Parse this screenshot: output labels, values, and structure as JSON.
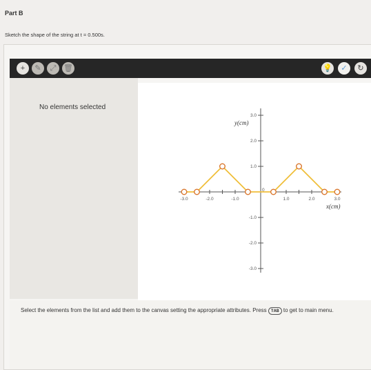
{
  "part_title": "Part B",
  "prompt": "Sketch the shape of the string at t = 0.500s.",
  "toolbar": {
    "add_icon": "plus-icon",
    "tool_icons": [
      "pen-icon",
      "transform-icon"
    ],
    "delete_icon": "trash-icon",
    "right_icons": [
      "hint-icon",
      "check-icon",
      "reset-icon"
    ]
  },
  "left_panel": {
    "status": "No elements selected"
  },
  "instructions": {
    "text_before": "Select the elements from the list and add them to the canvas setting the appropriate attributes. Press",
    "key": "TAB",
    "text_after": "to get to main menu."
  },
  "chart_data": {
    "type": "line",
    "xlabel": "x(cm)",
    "ylabel": "y(cm)",
    "origin_label": "0",
    "xlim": [
      -3.0,
      3.0
    ],
    "ylim": [
      -3.0,
      3.0
    ],
    "x_ticks": [
      "-3.0",
      "-2.0",
      "-1.0",
      "1.0",
      "2.0",
      "3.0"
    ],
    "y_ticks": [
      "3.0",
      "2.0",
      "1.0",
      "-1.0",
      "-2.0",
      "-3.0"
    ],
    "series": [
      {
        "color": "#f0bf3a",
        "points": [
          [
            -3.0,
            0
          ],
          [
            -2.5,
            0
          ],
          [
            -1.5,
            1.0
          ],
          [
            -0.5,
            0
          ],
          [
            0.5,
            0
          ],
          [
            1.5,
            1.0
          ],
          [
            2.5,
            0
          ],
          [
            3.0,
            0
          ]
        ]
      }
    ]
  }
}
